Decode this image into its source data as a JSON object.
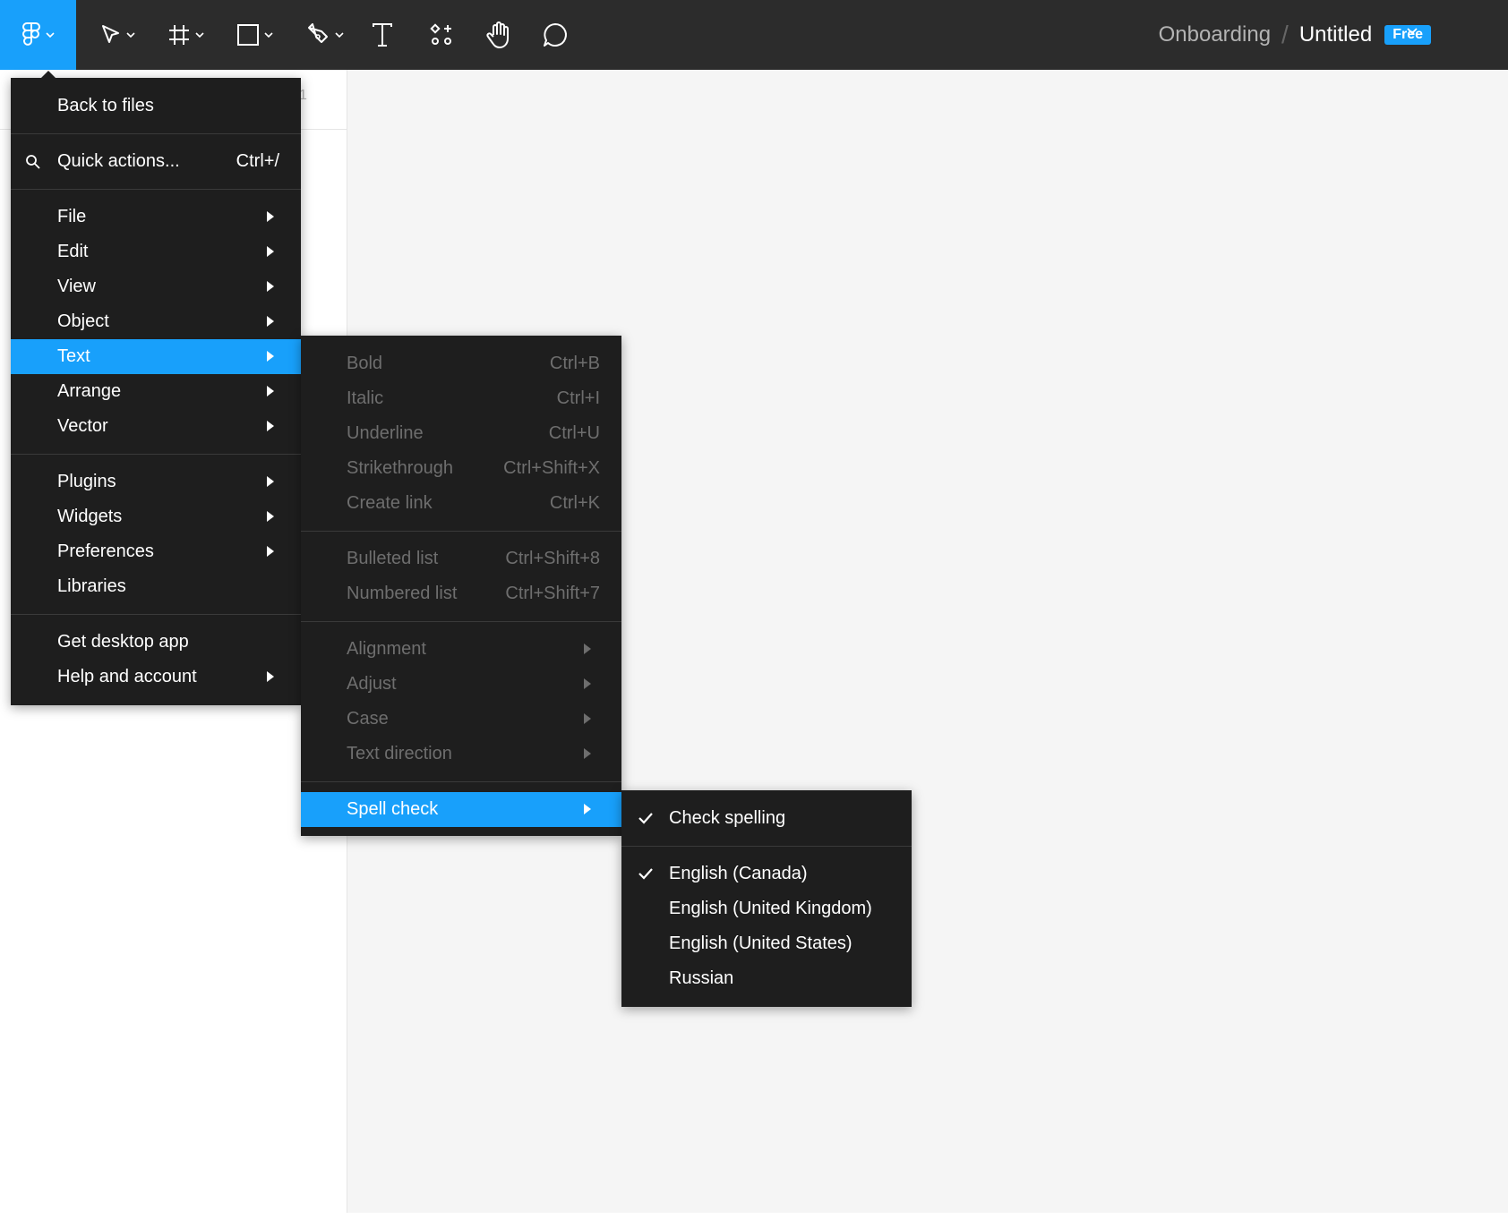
{
  "toolbar": {
    "tools": [
      {
        "icon": "figma-logo-icon",
        "has_dropdown": true,
        "active": true
      },
      {
        "icon": "move-pointer-icon",
        "has_dropdown": true
      },
      {
        "icon": "frame-icon",
        "has_dropdown": true
      },
      {
        "icon": "rectangle-icon",
        "has_dropdown": true
      },
      {
        "icon": "pen-icon",
        "has_dropdown": true
      },
      {
        "icon": "text-icon",
        "has_dropdown": false
      },
      {
        "icon": "resources-icon",
        "has_dropdown": false
      },
      {
        "icon": "hand-icon",
        "has_dropdown": false
      },
      {
        "icon": "comment-icon",
        "has_dropdown": false
      }
    ],
    "project_name": "Onboarding",
    "separator": "/",
    "file_name": "Untitled",
    "plan_badge": "Free"
  },
  "left_panel": {
    "ghost_text": "1"
  },
  "main_menu": {
    "back_to_files": "Back to files",
    "quick_actions": {
      "label": "Quick actions...",
      "shortcut": "Ctrl+/"
    },
    "items": [
      {
        "label": "File",
        "submenu": true
      },
      {
        "label": "Edit",
        "submenu": true
      },
      {
        "label": "View",
        "submenu": true
      },
      {
        "label": "Object",
        "submenu": true
      },
      {
        "label": "Text",
        "submenu": true,
        "active": true
      },
      {
        "label": "Arrange",
        "submenu": true
      },
      {
        "label": "Vector",
        "submenu": true
      }
    ],
    "items2": [
      {
        "label": "Plugins",
        "submenu": true
      },
      {
        "label": "Widgets",
        "submenu": true
      },
      {
        "label": "Preferences",
        "submenu": true
      },
      {
        "label": "Libraries",
        "submenu": false
      }
    ],
    "items3": [
      {
        "label": "Get desktop app",
        "submenu": false
      },
      {
        "label": "Help and account",
        "submenu": true
      }
    ]
  },
  "text_menu": {
    "formatting": [
      {
        "label": "Bold",
        "shortcut": "Ctrl+B"
      },
      {
        "label": "Italic",
        "shortcut": "Ctrl+I"
      },
      {
        "label": "Underline",
        "shortcut": "Ctrl+U"
      },
      {
        "label": "Strikethrough",
        "shortcut": "Ctrl+Shift+X"
      },
      {
        "label": "Create link",
        "shortcut": "Ctrl+K"
      }
    ],
    "lists": [
      {
        "label": "Bulleted list",
        "shortcut": "Ctrl+Shift+8"
      },
      {
        "label": "Numbered list",
        "shortcut": "Ctrl+Shift+7"
      }
    ],
    "submenus": [
      {
        "label": "Alignment"
      },
      {
        "label": "Adjust"
      },
      {
        "label": "Case"
      },
      {
        "label": "Text direction"
      }
    ],
    "spell_check": {
      "label": "Spell check"
    }
  },
  "spell_menu": {
    "check_spelling": {
      "label": "Check spelling",
      "checked": true
    },
    "languages": [
      {
        "label": "English (Canada)",
        "checked": true
      },
      {
        "label": "English (United Kingdom)",
        "checked": false
      },
      {
        "label": "English (United States)",
        "checked": false
      },
      {
        "label": "Russian",
        "checked": false
      }
    ]
  },
  "colors": {
    "toolbar_bg": "#2c2c2c",
    "menu_bg": "#1e1e1e",
    "accent": "#18a0fb",
    "canvas_bg": "#f5f5f5",
    "disabled_text": "#6e6e6e"
  }
}
